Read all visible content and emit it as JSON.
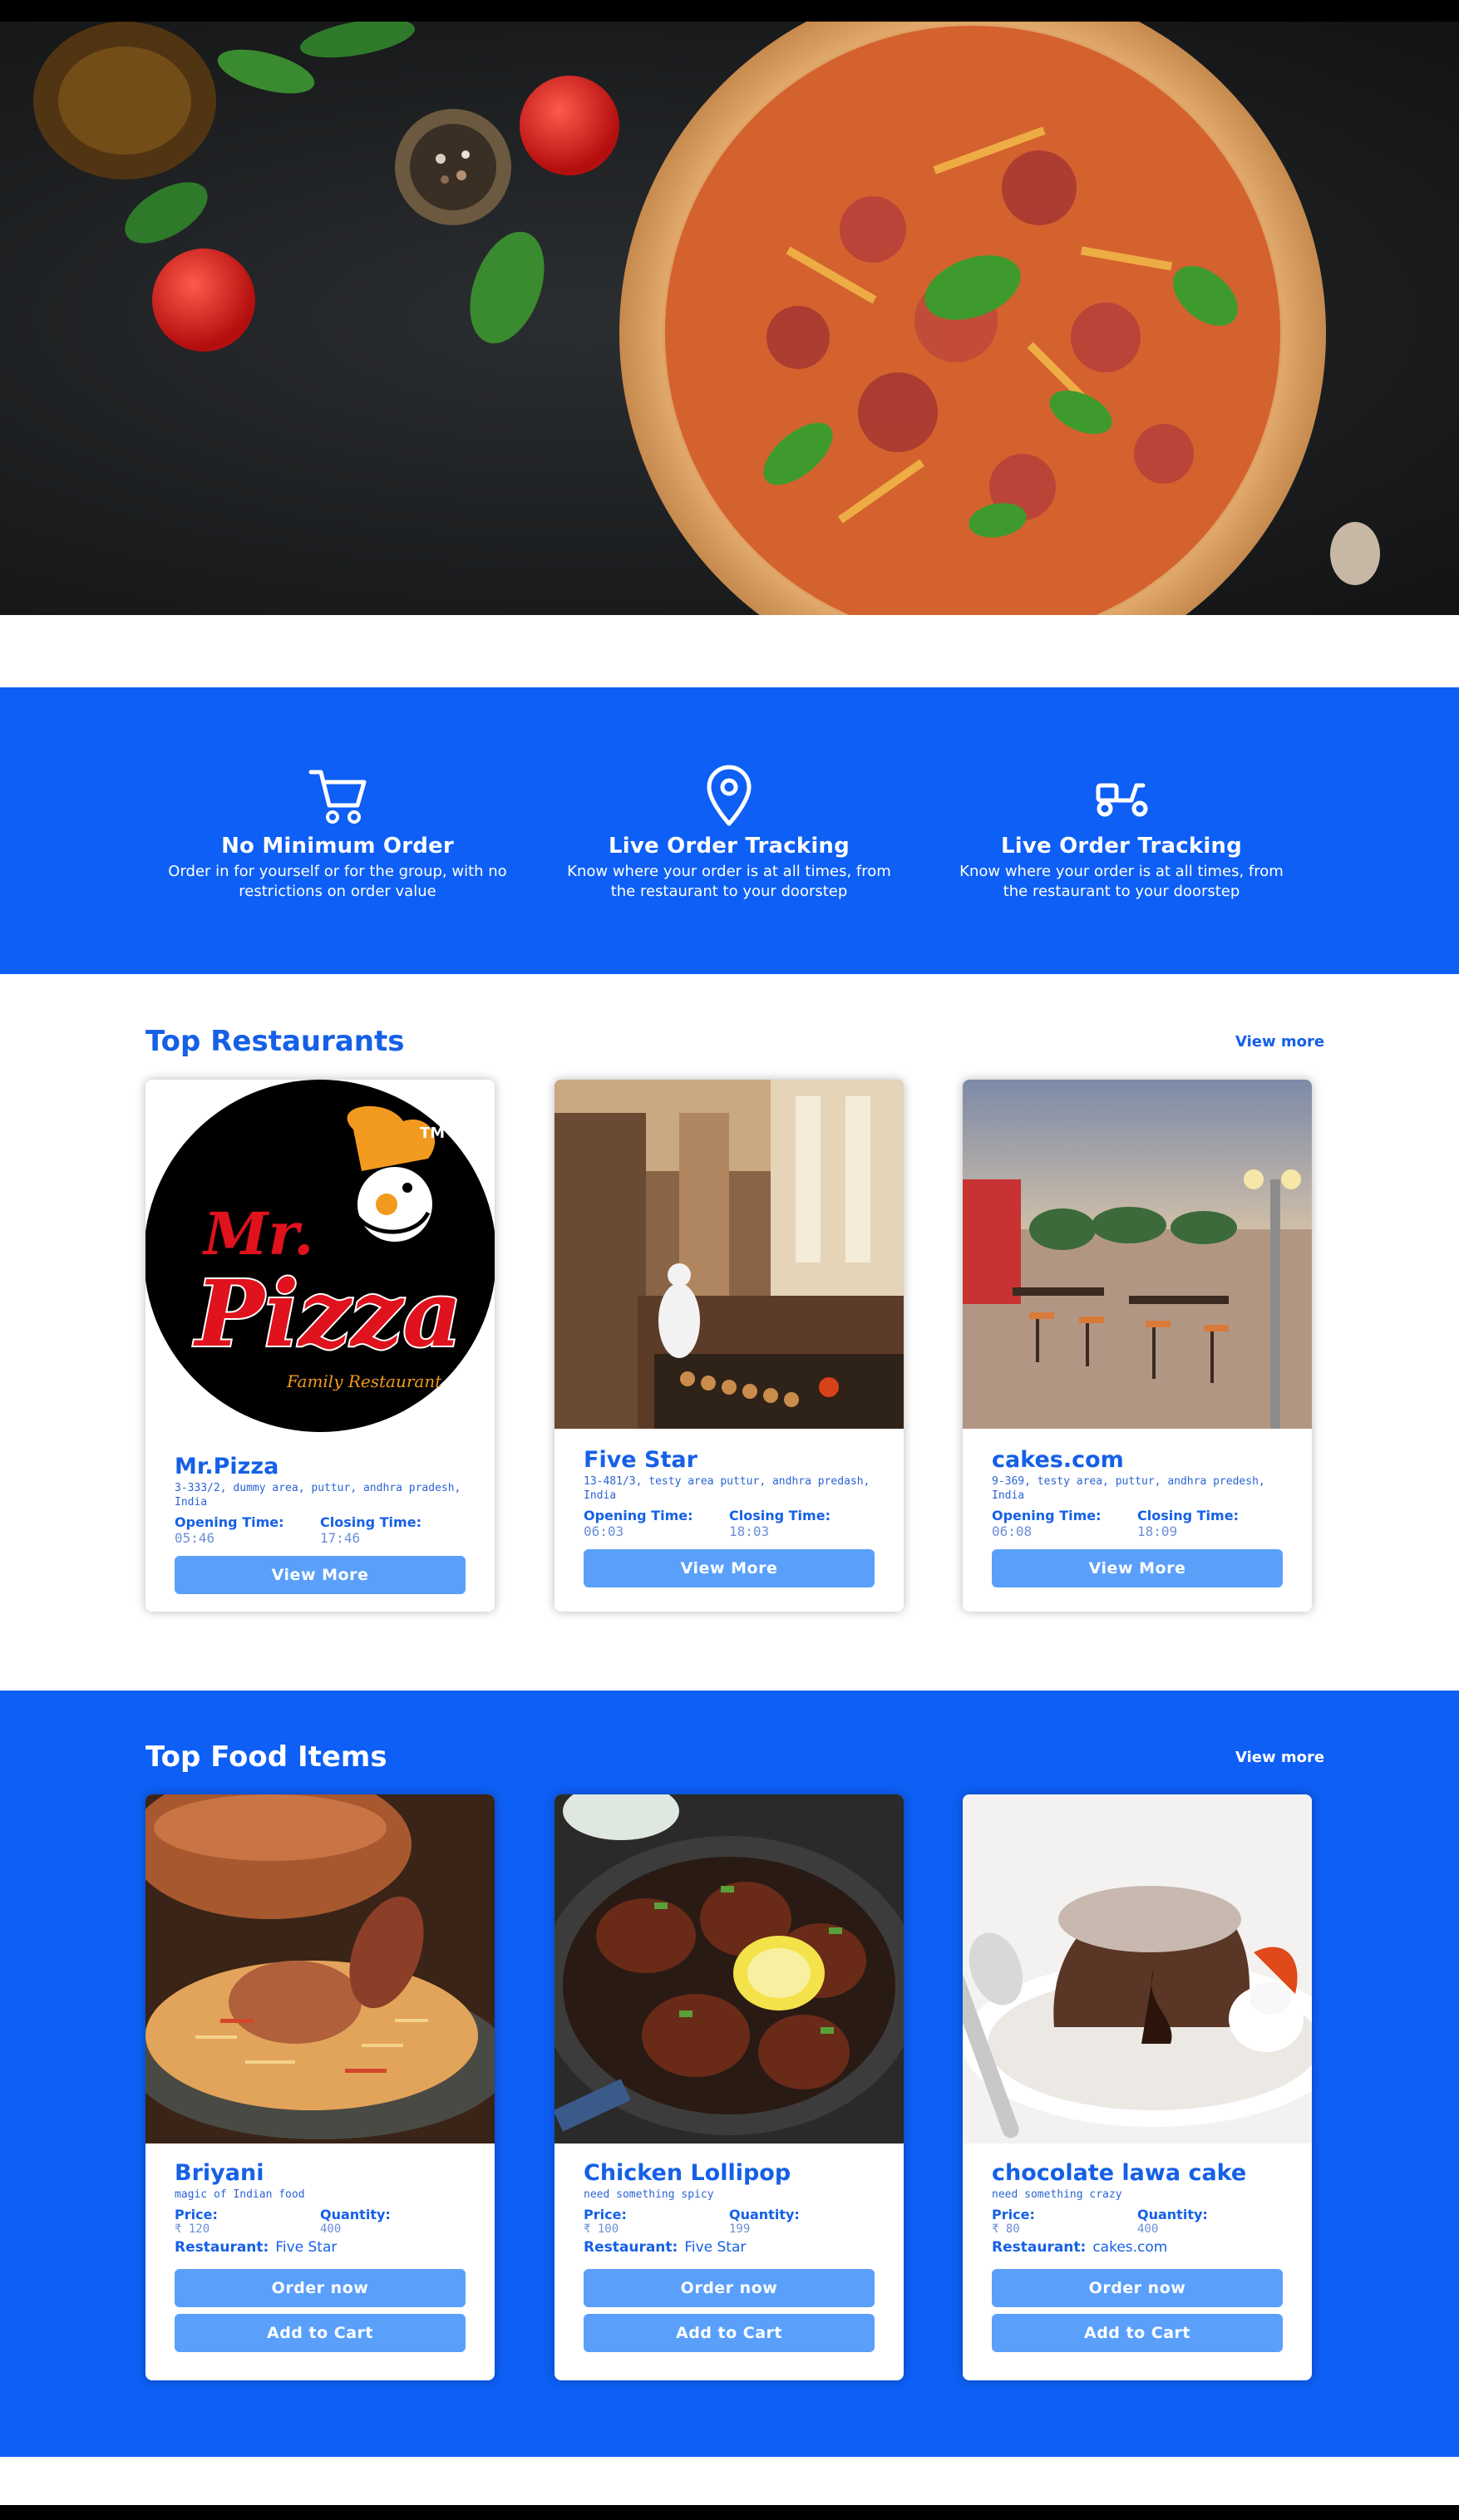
{
  "colors": {
    "brand_blue": "#0d5ff5",
    "button_blue": "#5aa0fb",
    "text_blue": "#1560e6"
  },
  "hero": {
    "image": "pizza-hero-image"
  },
  "features": [
    {
      "icon": "shopping-cart-icon",
      "title": "No Minimum Order",
      "text": "Order in for yourself or for the group, with no restrictions on order value"
    },
    {
      "icon": "location-pin-icon",
      "title": "Live Order Tracking",
      "text": "Know where your order is at all times, from the restaurant to your doorstep"
    },
    {
      "icon": "delivery-scooter-icon",
      "title": "Live Order Tracking",
      "text": "Know where your order is at all times, from the restaurant to your doorstep"
    }
  ],
  "restaurants": {
    "title": "Top Restaurants",
    "view_more": "View more",
    "opening_label": "Opening Time:",
    "closing_label": "Closing Time:",
    "button": "View More",
    "items": [
      {
        "name": "Mr.Pizza",
        "address": "3-333/2, dummy area, puttur, andhra pradesh, India",
        "opening": "05:46",
        "closing": "17:46"
      },
      {
        "name": "Five Star",
        "address": "13-481/3, testy area puttur, andhra predash, India",
        "opening": "06:03",
        "closing": "18:03"
      },
      {
        "name": "cakes.com",
        "address": "9-369, testy area, puttur, andhra predesh, India",
        "opening": "06:08",
        "closing": "18:09"
      }
    ]
  },
  "foods": {
    "title": "Top Food Items",
    "view_more": "View more",
    "price_label": "Price:",
    "quantity_label": "Quantity:",
    "restaurant_label": "Restaurant:",
    "order_button": "Order now",
    "cart_button": "Add to Cart",
    "items": [
      {
        "name": "Briyani",
        "tagline": "magic of Indian food",
        "price": "₹ 120",
        "quantity": "400",
        "restaurant": "Five Star"
      },
      {
        "name": "Chicken Lollipop",
        "tagline": "need something spicy",
        "price": "₹ 100",
        "quantity": "199",
        "restaurant": "Five Star"
      },
      {
        "name": "chocolate lawa cake",
        "tagline": "need something crazy",
        "price": "₹ 80",
        "quantity": "400",
        "restaurant": "cakes.com"
      }
    ]
  }
}
